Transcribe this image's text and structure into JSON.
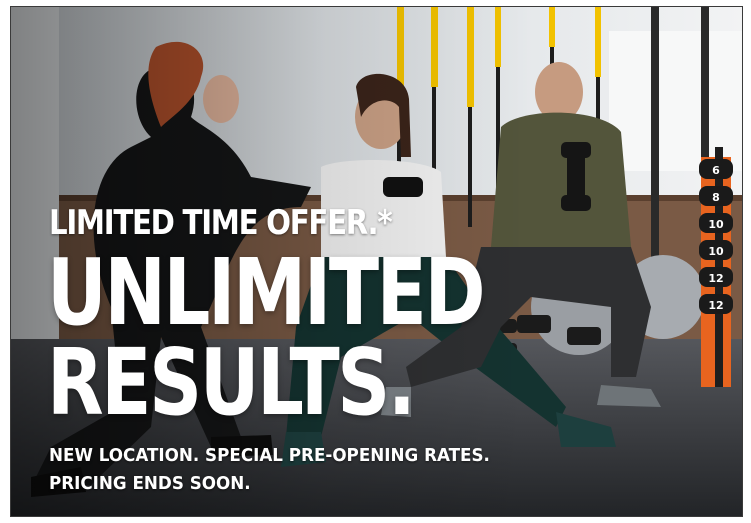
{
  "banner": {
    "eyebrow": "LIMITED TIME OFFER.*",
    "headline_line1": "UNLIMITED",
    "headline_line2": "RESULTS.",
    "sub_line1": "NEW LOCATION. SPECIAL PRE-OPENING RATES.",
    "sub_line2": "PRICING ENDS SOON."
  },
  "dumbbell_weights": [
    "6",
    "8",
    "10",
    "10",
    "12",
    "12"
  ],
  "colors": {
    "floor": "#2e3034",
    "wall": "#d9dde0",
    "accent_orange": "#e8641f",
    "strap_yellow": "#f2c200",
    "text": "#ffffff"
  }
}
